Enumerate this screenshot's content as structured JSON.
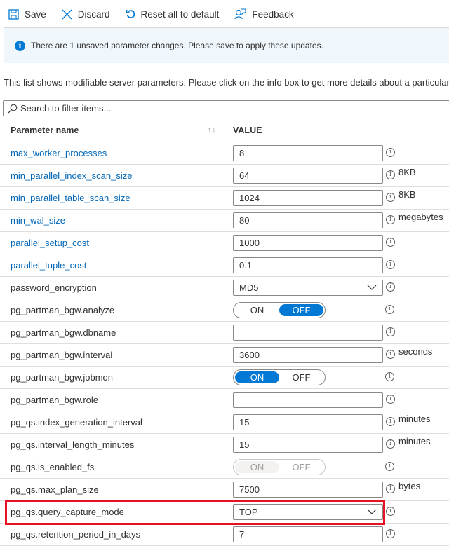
{
  "toolbar": {
    "save": "Save",
    "discard": "Discard",
    "reset": "Reset all to default",
    "feedback": "Feedback"
  },
  "banner": {
    "icon": "info-icon",
    "text": "There are 1 unsaved parameter changes.  Please save to apply these updates."
  },
  "description": "This list shows modifiable server parameters. Please click on the info box to get more details about a particular",
  "search": {
    "placeholder": "Search to filter items...",
    "value": ""
  },
  "table": {
    "header_name": "Parameter name",
    "header_sort": "↑↓",
    "header_value": "VALUE",
    "rows": [
      {
        "name": "max_worker_processes",
        "link": true,
        "type": "text",
        "value": "8",
        "unit": ""
      },
      {
        "name": "min_parallel_index_scan_size",
        "link": true,
        "type": "text",
        "value": "64",
        "unit": "8KB"
      },
      {
        "name": "min_parallel_table_scan_size",
        "link": true,
        "type": "text",
        "value": "1024",
        "unit": "8KB"
      },
      {
        "name": "min_wal_size",
        "link": true,
        "type": "text",
        "value": "80",
        "unit": "megabytes"
      },
      {
        "name": "parallel_setup_cost",
        "link": true,
        "type": "text",
        "value": "1000",
        "unit": ""
      },
      {
        "name": "parallel_tuple_cost",
        "link": true,
        "type": "text",
        "value": "0.1",
        "unit": ""
      },
      {
        "name": "password_encryption",
        "link": false,
        "type": "select",
        "value": "MD5",
        "unit": ""
      },
      {
        "name": "pg_partman_bgw.analyze",
        "link": false,
        "type": "toggle",
        "value": "OFF",
        "on_label": "ON",
        "off_label": "OFF",
        "disabled": false
      },
      {
        "name": "pg_partman_bgw.dbname",
        "link": false,
        "type": "text",
        "value": "",
        "unit": ""
      },
      {
        "name": "pg_partman_bgw.interval",
        "link": false,
        "type": "text",
        "value": "3600",
        "unit": "seconds"
      },
      {
        "name": "pg_partman_bgw.jobmon",
        "link": false,
        "type": "toggle",
        "value": "ON",
        "on_label": "ON",
        "off_label": "OFF",
        "disabled": false
      },
      {
        "name": "pg_partman_bgw.role",
        "link": false,
        "type": "text",
        "value": "",
        "unit": ""
      },
      {
        "name": "pg_qs.index_generation_interval",
        "link": false,
        "type": "text",
        "value": "15",
        "unit": "minutes"
      },
      {
        "name": "pg_qs.interval_length_minutes",
        "link": false,
        "type": "text",
        "value": "15",
        "unit": "minutes"
      },
      {
        "name": "pg_qs.is_enabled_fs",
        "link": false,
        "type": "toggle",
        "value": "ON",
        "on_label": "ON",
        "off_label": "OFF",
        "disabled": true
      },
      {
        "name": "pg_qs.max_plan_size",
        "link": false,
        "type": "text",
        "value": "7500",
        "unit": "bytes"
      },
      {
        "name": "pg_qs.query_capture_mode",
        "link": false,
        "type": "select",
        "value": "TOP",
        "unit": "",
        "highlighted": true
      },
      {
        "name": "pg_qs.retention_period_in_days",
        "link": false,
        "type": "text",
        "value": "7",
        "unit": ""
      }
    ]
  },
  "colors": {
    "accent": "#0078d4",
    "link": "#0067b8",
    "highlight": "#e81123",
    "banner_bg": "#eff6fc"
  }
}
